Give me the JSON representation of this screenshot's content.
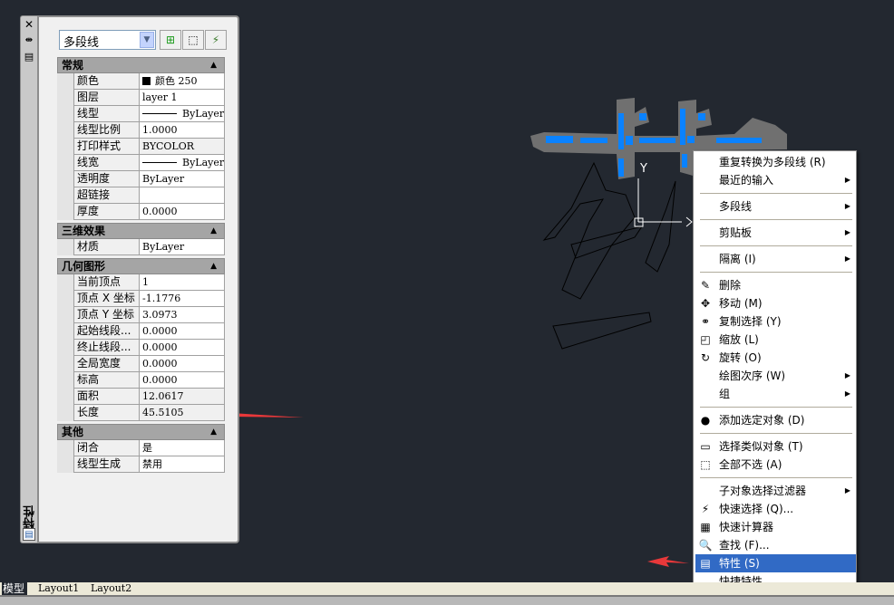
{
  "palette": {
    "canvas": "#232830",
    "highlight": "#316ac5",
    "arrow": "#e8383a",
    "grip": "#0a82ff"
  },
  "panel": {
    "side_title": "特性",
    "object_type": "多段线",
    "toolbar": [
      "toggle-pickadd-icon",
      "select-objects-icon",
      "quick-select-icon"
    ],
    "sections": [
      {
        "title": "常规",
        "rows": [
          {
            "key": "颜色",
            "value": "颜色 250",
            "swatch": true
          },
          {
            "key": "图层",
            "value": "layer 1"
          },
          {
            "key": "线型",
            "value": "ByLayer",
            "line": true
          },
          {
            "key": "线型比例",
            "value": "1.0000"
          },
          {
            "key": "打印样式",
            "value": "BYCOLOR",
            "readonly": true
          },
          {
            "key": "线宽",
            "value": "ByLayer",
            "line": true
          },
          {
            "key": "透明度",
            "value": "ByLayer"
          },
          {
            "key": "超链接",
            "value": ""
          },
          {
            "key": "厚度",
            "value": "0.0000"
          }
        ]
      },
      {
        "title": "三维效果",
        "rows": [
          {
            "key": "材质",
            "value": "ByLayer"
          }
        ]
      },
      {
        "title": "几何图形",
        "rows": [
          {
            "key": "当前顶点",
            "value": "1"
          },
          {
            "key": "顶点 X 坐标",
            "value": "-1.1776"
          },
          {
            "key": "顶点 Y 坐标",
            "value": "3.0973"
          },
          {
            "key": "起始线段...",
            "value": "0.0000"
          },
          {
            "key": "终止线段...",
            "value": "0.0000"
          },
          {
            "key": "全局宽度",
            "value": "0.0000"
          },
          {
            "key": "标高",
            "value": "0.0000"
          },
          {
            "key": "面积",
            "value": "12.0617",
            "readonly": true
          },
          {
            "key": "长度",
            "value": "45.5105",
            "readonly": true
          }
        ]
      },
      {
        "title": "其他",
        "rows": [
          {
            "key": "闭合",
            "value": "是"
          },
          {
            "key": "线型生成",
            "value": "禁用"
          }
        ]
      }
    ]
  },
  "menu": [
    {
      "label": "重复转换为多段线 (R)"
    },
    {
      "label": "最近的输入",
      "sub": true
    },
    {
      "sep": true
    },
    {
      "label": "多段线",
      "sub": true
    },
    {
      "sep": true
    },
    {
      "label": "剪贴板",
      "sub": true
    },
    {
      "sep": true
    },
    {
      "label": "隔离 (I)",
      "sub": true
    },
    {
      "sep": true
    },
    {
      "label": "删除",
      "icon": "✎"
    },
    {
      "label": "移动 (M)",
      "icon": "✥"
    },
    {
      "label": "复制选择 (Y)",
      "icon": "⚭"
    },
    {
      "label": "缩放 (L)",
      "icon": "◰"
    },
    {
      "label": "旋转 (O)",
      "icon": "↻"
    },
    {
      "label": "绘图次序 (W)",
      "sub": true
    },
    {
      "label": "组",
      "sub": true
    },
    {
      "sep": true
    },
    {
      "label": "添加选定对象 (D)",
      "icon": "●"
    },
    {
      "sep": true
    },
    {
      "label": "选择类似对象 (T)",
      "icon": "▭"
    },
    {
      "label": "全部不选 (A)",
      "icon": "⬚"
    },
    {
      "sep": true
    },
    {
      "label": "子对象选择过滤器",
      "sub": true
    },
    {
      "label": "快速选择 (Q)...",
      "icon": "⚡"
    },
    {
      "label": "快速计算器",
      "icon": "▦"
    },
    {
      "label": "查找 (F)...",
      "icon": "🔍"
    },
    {
      "label": "特性 (S)",
      "icon": "▤",
      "highlight": true
    },
    {
      "label": "快捷特性"
    }
  ],
  "tabs": [
    "模型",
    "Layout1",
    "Layout2"
  ],
  "ucs": {
    "y_label": "Y"
  }
}
